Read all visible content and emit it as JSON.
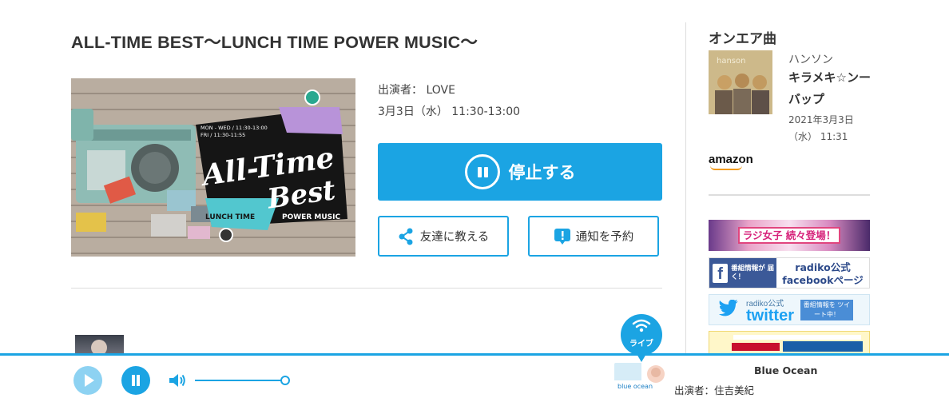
{
  "program": {
    "title": "ALL-TIME BEST〜LUNCH TIME POWER MUSIC〜",
    "cast_line": "出演者： LOVE",
    "datetime": "3月3日（水） 11:30-13:00",
    "stop_label": "停止する",
    "share_label": "友達に教える",
    "notify_label": "通知を予約",
    "art": {
      "schedule_line1": "MON - WED / 11:30-13:00",
      "schedule_line2": "FRI / 11:30-11:55",
      "logo_line1": "All-Time",
      "logo_line2": "Best",
      "tag_left": "LUNCH TIME",
      "tag_right": "POWER MUSIC"
    }
  },
  "onair": {
    "heading": "オンエア曲",
    "artist": "ハンソン",
    "song": "キラメキ☆ンー　バップ",
    "played_at": "2021年3月3日（水） 11:31",
    "jacket_text": "hanson",
    "amazon_label": "amazon"
  },
  "banners": {
    "radio_girls": "ラジ女子 続々登場！",
    "facebook_side": "番組情報が 届く！",
    "facebook_text": "radiko公式 facebookページ",
    "twitter_small": "radiko公式",
    "twitter_large": "twitter",
    "twitter_box": "番組情報を ツイート中！"
  },
  "player": {
    "live_label": "ライブ",
    "station_name": "Blue Ocean",
    "station_cast": "出演者：住吉美紀",
    "station_logo_text": "blue ocean"
  },
  "colors": {
    "accent": "#1ba4e3",
    "play_disabled": "#8dd2f2",
    "facebook": "#3b5998",
    "twitter": "#1da1f2",
    "amazon_smile": "#f29b1e"
  }
}
